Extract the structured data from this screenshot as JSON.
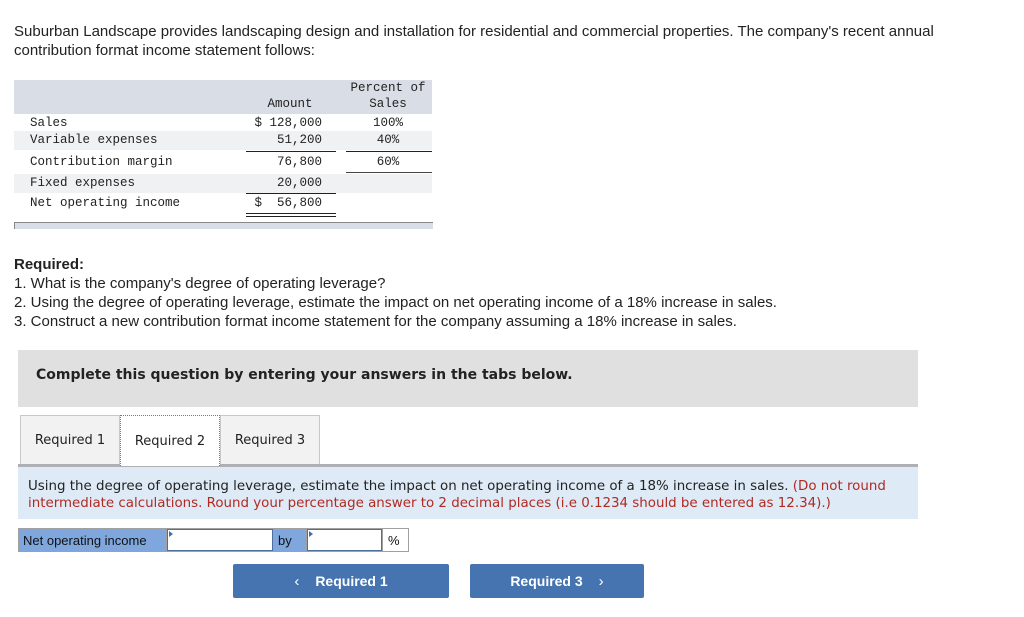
{
  "intro": "Suburban Landscape provides landscaping design and installation for residential and commercial properties. The company's recent annual contribution format income statement follows:",
  "statement": {
    "headers": {
      "amount": "Amount",
      "percent_line1": "Percent of",
      "percent_line2": "Sales"
    },
    "rows": [
      {
        "label": "Sales",
        "amount": "$ 128,000",
        "percent": "100%"
      },
      {
        "label": "Variable expenses",
        "amount": "51,200",
        "percent": "40%"
      },
      {
        "label": "Contribution margin",
        "amount": "76,800",
        "percent": "60%"
      },
      {
        "label": "Fixed expenses",
        "amount": "20,000",
        "percent": ""
      },
      {
        "label": "Net operating income",
        "amount": "$  56,800",
        "percent": ""
      }
    ]
  },
  "required": {
    "title": "Required:",
    "items": [
      "1. What is the company's degree of operating leverage?",
      "2. Using the degree of operating leverage, estimate the impact on net operating income of a 18% increase in sales.",
      "3. Construct a new contribution format income statement for the company assuming a 18% increase in sales."
    ]
  },
  "instruction": "Complete this question by entering your answers in the tabs below.",
  "tabs": [
    {
      "label": "Required 1",
      "active": false
    },
    {
      "label": "Required 2",
      "active": true
    },
    {
      "label": "Required 3",
      "active": false
    }
  ],
  "panel": {
    "text": "Using the degree of operating leverage, estimate the impact on net operating income of a 18% increase in sales.",
    "note": "(Do not round intermediate calculations. Round your percentage answer to 2 decimal places (i.e 0.1234 should be entered as 12.34).)"
  },
  "answer": {
    "label": "Net operating income",
    "direction_value": "",
    "by_label": "by",
    "percent_value": "",
    "percent_sign": "%"
  },
  "nav": {
    "prev_label": "Required 1",
    "next_label": "Required 3",
    "prev_icon": "‹",
    "next_icon": "›"
  }
}
